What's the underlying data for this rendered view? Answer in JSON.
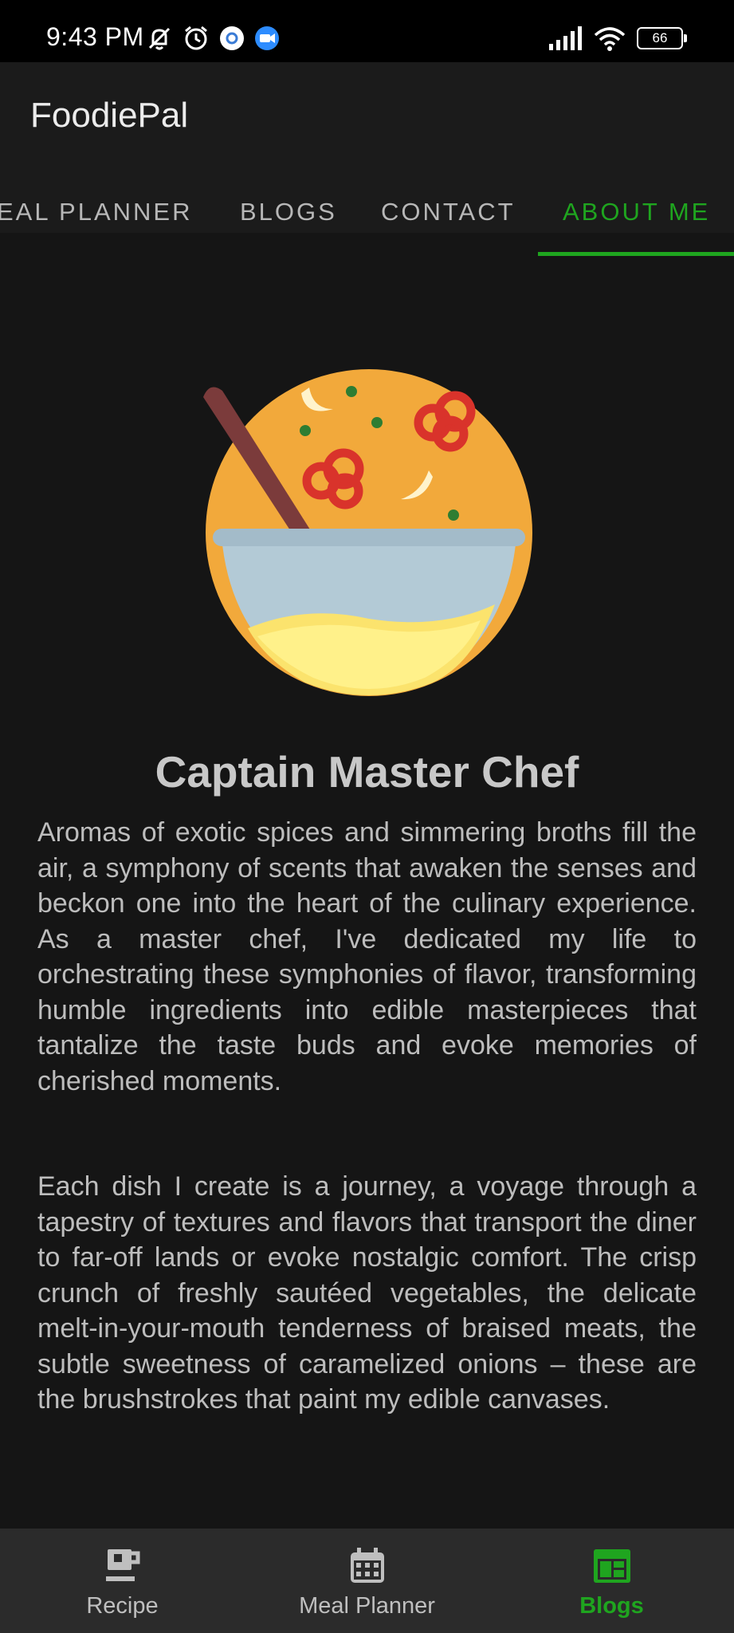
{
  "status": {
    "time": "9:43 PM",
    "battery": "66"
  },
  "app": {
    "title": "FoodiePal"
  },
  "tabs": [
    {
      "label": "EAL PLANNER"
    },
    {
      "label": "BLOGS"
    },
    {
      "label": "CONTACT"
    },
    {
      "label": "ABOUT ME"
    }
  ],
  "content": {
    "title": "Captain Master Chef",
    "paragraph1": "Aromas of exotic spices and simmering broths fill the air, a symphony of scents that awaken the senses and beckon one into the heart of the culinary experience. As a master chef, I've dedicated my life to orchestrating these symphonies of flavor, transforming humble ingredients into edible masterpieces that tantalize the taste buds and evoke memories of cherished moments.",
    "paragraph2": "Each dish I create is a journey, a voyage through a tapestry of textures and flavors that transport the diner to far-off lands or evoke nostalgic comfort. The crisp crunch of freshly sautéed vegetables, the delicate melt-in-your-mouth tenderness of braised meats, the subtle sweetness of caramelized onions – these are the brushstrokes that paint my edible canvases."
  },
  "bottom_nav": [
    {
      "label": "Recipe",
      "icon": "cup-icon"
    },
    {
      "label": "Meal Planner",
      "icon": "calendar-icon"
    },
    {
      "label": "Blogs",
      "icon": "blog-icon"
    }
  ],
  "colors": {
    "accent": "#1fa51f",
    "background": "#151515",
    "appbar": "#1b1b1b",
    "bottom_nav": "#2b2b2b"
  }
}
